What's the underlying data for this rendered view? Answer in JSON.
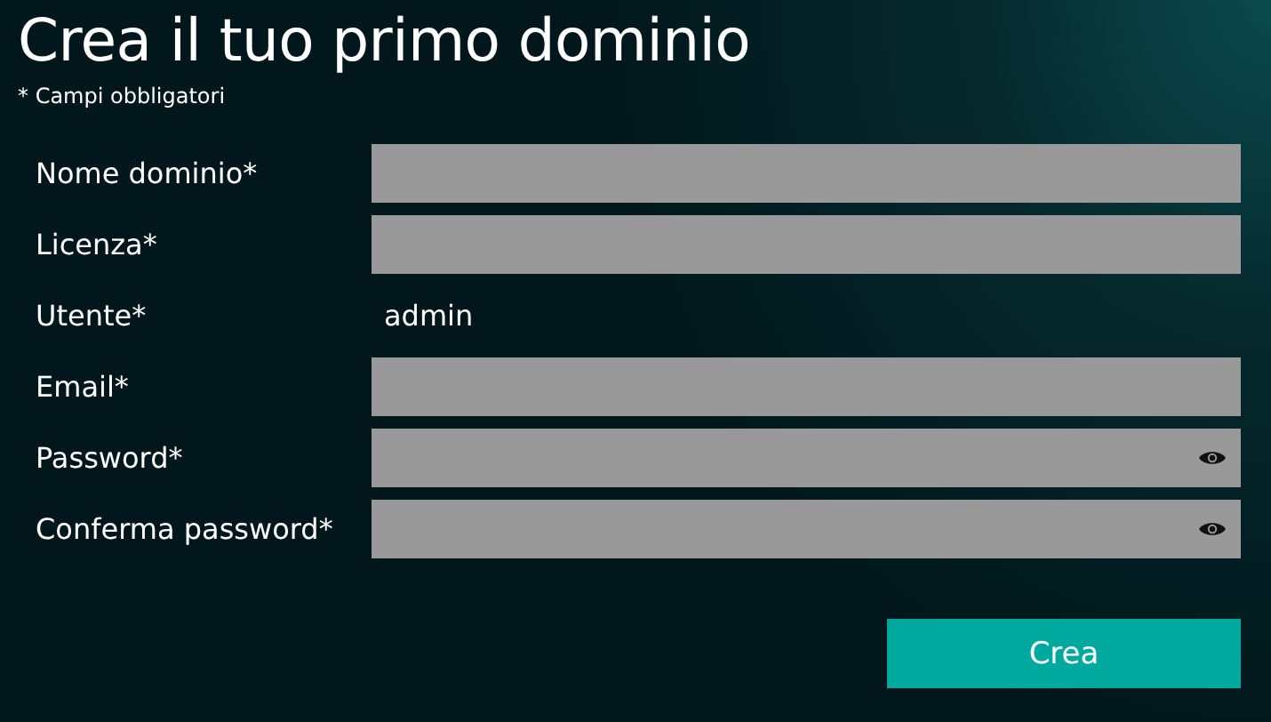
{
  "title": "Crea il tuo primo dominio",
  "subtitle": "* Campi obbligatori",
  "fields": [
    {
      "label": "Nome dominio*",
      "kind": "input"
    },
    {
      "label": "Licenza*",
      "kind": "input"
    },
    {
      "label": "Utente*",
      "kind": "static",
      "value": "admin"
    },
    {
      "label": "Email*",
      "kind": "input"
    },
    {
      "label": "Password*",
      "kind": "password"
    },
    {
      "label": "Conferma password*",
      "kind": "password"
    }
  ],
  "submit": "Crea"
}
